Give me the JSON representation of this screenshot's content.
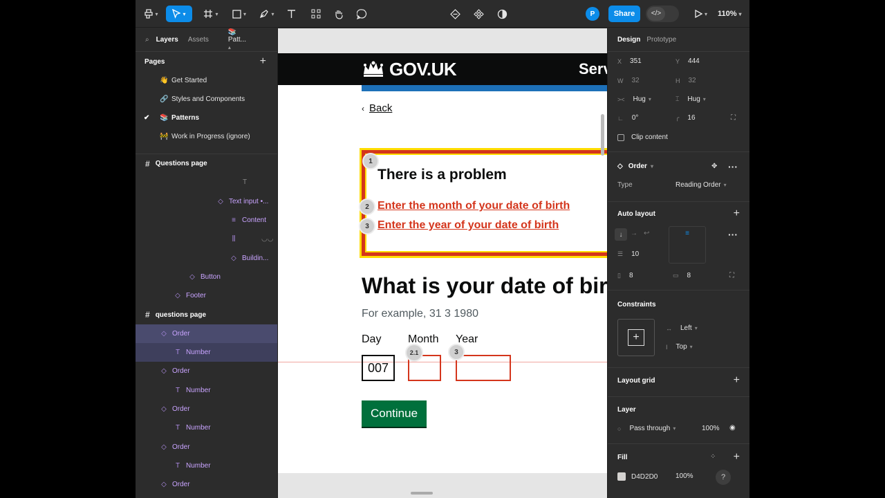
{
  "toolbar": {
    "avatar_initial": "P",
    "share_label": "Share",
    "zoom_label": "110%",
    "dev_mode_label": "</>"
  },
  "left_panel": {
    "tabs": [
      "Layers",
      "Assets",
      "Patt..."
    ],
    "pages_title": "Pages",
    "pages": [
      {
        "icon": "👋",
        "label": "Get Started"
      },
      {
        "icon": "🔗",
        "label": "Styles and Components"
      },
      {
        "icon": "📚",
        "label": "Patterns",
        "checked": true
      },
      {
        "icon": "🚧",
        "label": "Work in Progress (ignore)"
      }
    ],
    "frames": {
      "questions_page_1": "Questions page",
      "questions_page_2": "questions page"
    },
    "layers_a": [
      {
        "icon": "T",
        "label": ""
      },
      {
        "icon": "◇",
        "label": "Text input •..."
      },
      {
        "icon": "≡",
        "label": "Content"
      },
      {
        "icon": "⫼",
        "label": ""
      },
      {
        "icon": "◇",
        "label": "Buildin..."
      },
      {
        "icon": "◇",
        "label": "Button"
      },
      {
        "icon": "◇",
        "label": "Footer"
      }
    ],
    "layers_b": [
      {
        "icon": "◇",
        "label": "Order"
      },
      {
        "icon": "T",
        "label": "Number"
      },
      {
        "icon": "◇",
        "label": "Order"
      },
      {
        "icon": "T",
        "label": "Number"
      },
      {
        "icon": "◇",
        "label": "Order"
      },
      {
        "icon": "T",
        "label": "Number"
      },
      {
        "icon": "◇",
        "label": "Order"
      },
      {
        "icon": "T",
        "label": "Number"
      },
      {
        "icon": "◇",
        "label": "Order"
      }
    ]
  },
  "canvas": {
    "gov_logo": "GOV.UK",
    "service_name": "Serv",
    "back_label": "Back",
    "error_title": "There is a problem",
    "error_links": [
      "Enter the month of your date of birth",
      "Enter the year of your date of birth"
    ],
    "badges": [
      "1",
      "2",
      "3",
      "2.1",
      "3"
    ],
    "question": "What is your date of birt",
    "hint": "For example, 31 3 1980",
    "date_labels": [
      "Day",
      "Month",
      "Year"
    ],
    "day_value": "007",
    "continue_label": "Continue"
  },
  "right_panel": {
    "tabs": [
      "Design",
      "Prototype"
    ],
    "x_label": "X",
    "x_value": "351",
    "y_label": "Y",
    "y_value": "444",
    "w_label": "W",
    "w_value": "32",
    "h_label": "H",
    "h_value": "32",
    "width_mode": "Hug",
    "height_mode": "Hug",
    "rotation": "0°",
    "radius": "16",
    "clip_content_label": "Clip content",
    "component_name": "Order",
    "type_label": "Type",
    "type_value": "Reading Order",
    "auto_layout_title": "Auto layout",
    "gap_value": "10",
    "padding_h": "8",
    "padding_v": "8",
    "constraints_title": "Constraints",
    "constraint_h": "Left",
    "constraint_v": "Top",
    "layout_grid_title": "Layout grid",
    "layer_title": "Layer",
    "blend_mode": "Pass through",
    "layer_opacity": "100%",
    "fill_title": "Fill",
    "fill_hex": "D4D2D0",
    "fill_opacity": "100%",
    "fill_color": "#D4D2D0"
  }
}
